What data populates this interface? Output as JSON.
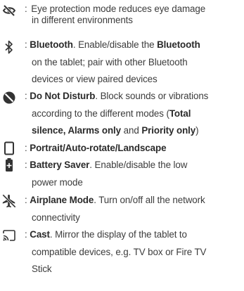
{
  "items": [
    {
      "icon": "eye-protection-icon",
      "line1": "Eye protection mode reduces eye damage",
      "line2": "in different environments"
    },
    {
      "icon": "bluetooth-icon",
      "name": "Bluetooth",
      "desc_a": ". Enable/disable the ",
      "desc_b": "Bluetooth",
      "line2": "on the tablet; pair with other  Bluetooth",
      "line3": "devices or view paired devices"
    },
    {
      "icon": "do-not-disturb-icon",
      "name": "Do Not Disturb",
      "desc_a": ". Block sounds or vibrations",
      "line2_a": "according to the different modes (",
      "line2_b": "Total",
      "line3_a": "silence, Alarms only",
      "line3_b": " and ",
      "line3_c": "Priority only",
      "line3_d": ")"
    },
    {
      "icon": "portrait-rotate-icon",
      "name": "Portrait/Auto-rotate/Landscape"
    },
    {
      "icon": "battery-saver-icon",
      "name": "Battery Saver",
      "desc_a": ". Enable/disable the low",
      "line2": "power mode"
    },
    {
      "icon": "airplane-mode-icon",
      "name": "Airplane Mode",
      "desc_a": ". Turn on/off all the network",
      "line2": "connectivity"
    },
    {
      "icon": "cast-icon",
      "name": "Cast",
      "desc_a": ". Mirror the display of the tablet to",
      "line2": "compatible devices, e.g. TV box or Fire TV",
      "line3": "Stick"
    }
  ],
  "separator": ": ",
  "colors": {
    "text": "#3c3c3c",
    "icon": "#333333"
  }
}
